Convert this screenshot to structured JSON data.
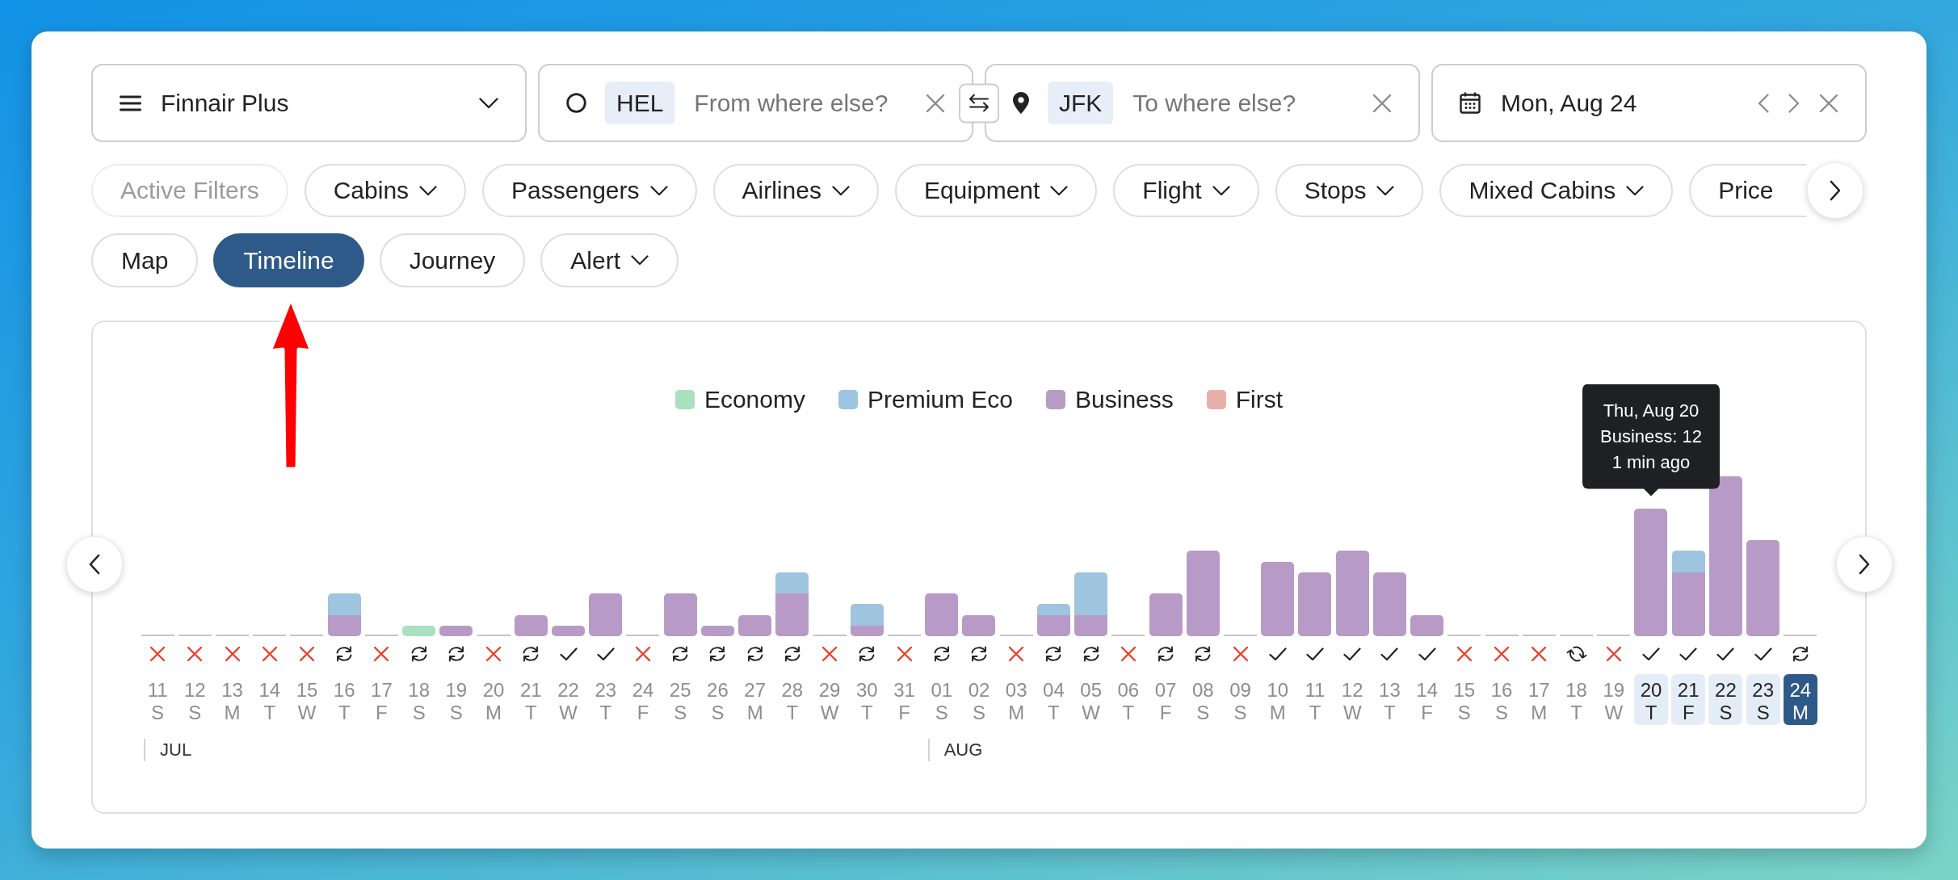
{
  "program_select": {
    "value": "Finnair Plus"
  },
  "origin": {
    "code": "HEL",
    "placeholder": "From where else?"
  },
  "destination": {
    "code": "JFK",
    "placeholder": "To where else?"
  },
  "date": {
    "value": "Mon, Aug 24"
  },
  "filters": [
    {
      "label": "Active Filters",
      "disabled": true,
      "dropdown": false
    },
    {
      "label": "Cabins",
      "disabled": false,
      "dropdown": true
    },
    {
      "label": "Passengers",
      "disabled": false,
      "dropdown": true
    },
    {
      "label": "Airlines",
      "disabled": false,
      "dropdown": true
    },
    {
      "label": "Equipment",
      "disabled": false,
      "dropdown": true
    },
    {
      "label": "Flight",
      "disabled": false,
      "dropdown": true
    },
    {
      "label": "Stops",
      "disabled": false,
      "dropdown": true
    },
    {
      "label": "Mixed Cabins",
      "disabled": false,
      "dropdown": true
    },
    {
      "label": "Price",
      "disabled": false,
      "dropdown": false
    }
  ],
  "views": [
    {
      "label": "Map",
      "selected": false,
      "dropdown": false
    },
    {
      "label": "Timeline",
      "selected": true,
      "dropdown": false
    },
    {
      "label": "Journey",
      "selected": false,
      "dropdown": false
    },
    {
      "label": "Alert",
      "selected": false,
      "dropdown": true
    }
  ],
  "chart": {
    "legend": [
      {
        "label": "Economy",
        "color": "#a8e0c0"
      },
      {
        "label": "Premium Eco",
        "color": "#9ec4e0"
      },
      {
        "label": "Business",
        "color": "#b79bc6"
      },
      {
        "label": "First",
        "color": "#e8b0aa"
      }
    ],
    "days": [
      {
        "day": "11",
        "weekday": "S",
        "status": {
          "kind": "unavailable"
        },
        "highlighted": false,
        "selected": false,
        "month": "JUL"
      },
      {
        "day": "12",
        "weekday": "S",
        "status": {
          "kind": "unavailable"
        },
        "highlighted": false,
        "selected": false
      },
      {
        "day": "13",
        "weekday": "M",
        "status": {
          "kind": "unavailable"
        },
        "highlighted": false,
        "selected": false
      },
      {
        "day": "14",
        "weekday": "T",
        "status": {
          "kind": "unavailable"
        },
        "highlighted": false,
        "selected": false
      },
      {
        "day": "15",
        "weekday": "W",
        "status": {
          "kind": "unavailable"
        },
        "highlighted": false,
        "selected": false
      },
      {
        "day": "16",
        "weekday": "T",
        "status": {
          "kind": "refresh"
        },
        "highlighted": false,
        "selected": false
      },
      {
        "day": "17",
        "weekday": "F",
        "status": {
          "kind": "unavailable"
        },
        "highlighted": false,
        "selected": false
      },
      {
        "day": "18",
        "weekday": "S",
        "status": {
          "kind": "refresh"
        },
        "highlighted": false,
        "selected": false
      },
      {
        "day": "19",
        "weekday": "S",
        "status": {
          "kind": "refresh"
        },
        "highlighted": false,
        "selected": false
      },
      {
        "day": "20",
        "weekday": "M",
        "status": {
          "kind": "unavailable"
        },
        "highlighted": false,
        "selected": false
      },
      {
        "day": "21",
        "weekday": "T",
        "status": {
          "kind": "refresh"
        },
        "highlighted": false,
        "selected": false
      },
      {
        "day": "22",
        "weekday": "W",
        "status": {
          "kind": "available"
        },
        "highlighted": false,
        "selected": false
      },
      {
        "day": "23",
        "weekday": "T",
        "status": {
          "kind": "available"
        },
        "highlighted": false,
        "selected": false
      },
      {
        "day": "24",
        "weekday": "F",
        "status": {
          "kind": "unavailable"
        },
        "highlighted": false,
        "selected": false
      },
      {
        "day": "25",
        "weekday": "S",
        "status": {
          "kind": "refresh"
        },
        "highlighted": false,
        "selected": false
      },
      {
        "day": "26",
        "weekday": "S",
        "status": {
          "kind": "refresh"
        },
        "highlighted": false,
        "selected": false
      },
      {
        "day": "27",
        "weekday": "M",
        "status": {
          "kind": "refresh"
        },
        "highlighted": false,
        "selected": false
      },
      {
        "day": "28",
        "weekday": "T",
        "status": {
          "kind": "refresh"
        },
        "highlighted": false,
        "selected": false
      },
      {
        "day": "29",
        "weekday": "W",
        "status": {
          "kind": "unavailable"
        },
        "highlighted": false,
        "selected": false
      },
      {
        "day": "30",
        "weekday": "T",
        "status": {
          "kind": "refresh"
        },
        "highlighted": false,
        "selected": false
      },
      {
        "day": "31",
        "weekday": "F",
        "status": {
          "kind": "unavailable"
        },
        "highlighted": false,
        "selected": false
      },
      {
        "day": "01",
        "weekday": "S",
        "status": {
          "kind": "refresh"
        },
        "highlighted": false,
        "selected": false,
        "month": "AUG"
      },
      {
        "day": "02",
        "weekday": "S",
        "status": {
          "kind": "refresh"
        },
        "highlighted": false,
        "selected": false
      },
      {
        "day": "03",
        "weekday": "M",
        "status": {
          "kind": "unavailable"
        },
        "highlighted": false,
        "selected": false
      },
      {
        "day": "04",
        "weekday": "T",
        "status": {
          "kind": "refresh"
        },
        "highlighted": false,
        "selected": false
      },
      {
        "day": "05",
        "weekday": "W",
        "status": {
          "kind": "refresh"
        },
        "highlighted": false,
        "selected": false
      },
      {
        "day": "06",
        "weekday": "T",
        "status": {
          "kind": "unavailable"
        },
        "highlighted": false,
        "selected": false
      },
      {
        "day": "07",
        "weekday": "F",
        "status": {
          "kind": "refresh"
        },
        "highlighted": false,
        "selected": false
      },
      {
        "day": "08",
        "weekday": "S",
        "status": {
          "kind": "refresh"
        },
        "highlighted": false,
        "selected": false
      },
      {
        "day": "09",
        "weekday": "S",
        "status": {
          "kind": "unavailable"
        },
        "highlighted": false,
        "selected": false
      },
      {
        "day": "10",
        "weekday": "M",
        "status": {
          "kind": "available"
        },
        "highlighted": false,
        "selected": false
      },
      {
        "day": "11",
        "weekday": "T",
        "status": {
          "kind": "available"
        },
        "highlighted": false,
        "selected": false
      },
      {
        "day": "12",
        "weekday": "W",
        "status": {
          "kind": "available"
        },
        "highlighted": false,
        "selected": false
      },
      {
        "day": "13",
        "weekday": "T",
        "status": {
          "kind": "available"
        },
        "highlighted": false,
        "selected": false
      },
      {
        "day": "14",
        "weekday": "F",
        "status": {
          "kind": "available"
        },
        "highlighted": false,
        "selected": false
      },
      {
        "day": "15",
        "weekday": "S",
        "status": {
          "kind": "unavailable"
        },
        "highlighted": false,
        "selected": false
      },
      {
        "day": "16",
        "weekday": "S",
        "status": {
          "kind": "unavailable"
        },
        "highlighted": false,
        "selected": false
      },
      {
        "day": "17",
        "weekday": "M",
        "status": {
          "kind": "unavailable"
        },
        "highlighted": false,
        "selected": false
      },
      {
        "day": "18",
        "weekday": "T",
        "status": {
          "kind": "syncing"
        },
        "highlighted": false,
        "selected": false
      },
      {
        "day": "19",
        "weekday": "W",
        "status": {
          "kind": "unavailable"
        },
        "highlighted": false,
        "selected": false
      },
      {
        "day": "20",
        "weekday": "T",
        "status": {
          "kind": "available"
        },
        "highlighted": true,
        "selected": false,
        "tooltip": [
          "Thu, Aug 20",
          "Business: 12",
          "1 min ago"
        ]
      },
      {
        "day": "21",
        "weekday": "F",
        "status": {
          "kind": "available"
        },
        "highlighted": true,
        "selected": false
      },
      {
        "day": "22",
        "weekday": "S",
        "status": {
          "kind": "available"
        },
        "highlighted": true,
        "selected": false
      },
      {
        "day": "23",
        "weekday": "S",
        "status": {
          "kind": "available"
        },
        "highlighted": true,
        "selected": false
      },
      {
        "day": "24",
        "weekday": "M",
        "status": {
          "kind": "refresh"
        },
        "highlighted": false,
        "selected": true
      }
    ]
  }
}
